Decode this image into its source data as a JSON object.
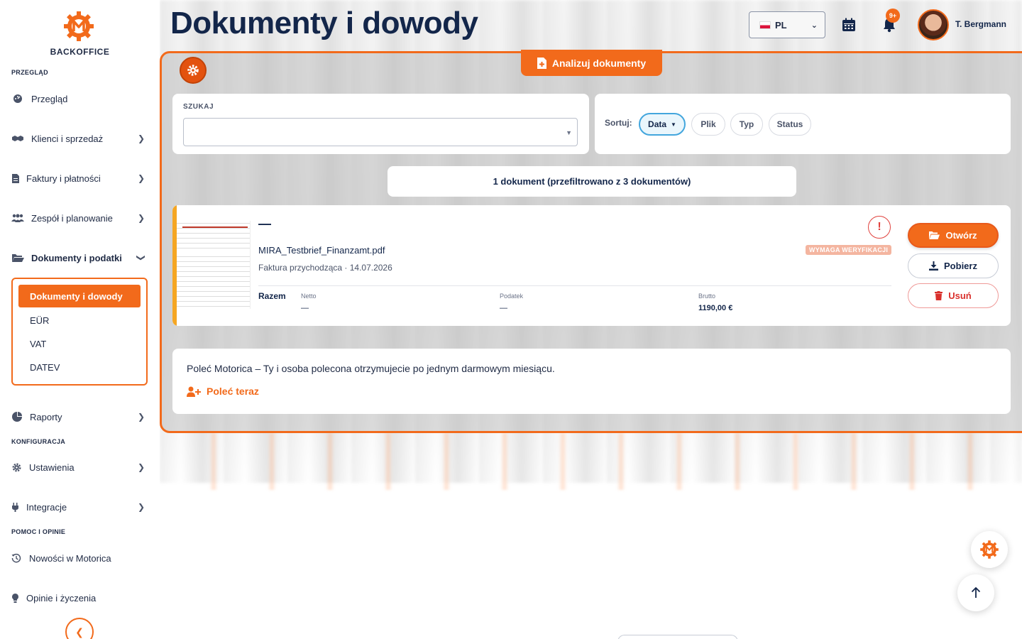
{
  "brand": {
    "name": "BACKOFFICE",
    "accent": "#f26a1b",
    "navy": "#13264a"
  },
  "header": {
    "title": "Dokumenty i dowody",
    "language": "PL",
    "notifications_badge": "9+",
    "user_name": "T. Bergmann"
  },
  "sidebar": {
    "sections": {
      "overview": "PRZEGLĄD",
      "config": "KONFIGURACJA",
      "help": "POMOC I OPINIE"
    },
    "items": {
      "overview": "Przegląd",
      "clients": "Klienci i sprzedaż",
      "invoices": "Faktury i płatności",
      "team": "Zespół i planowanie",
      "documents": "Dokumenty i podatki",
      "reports": "Raporty",
      "settings": "Ustawienia",
      "integrations": "Integracje",
      "news": "Nowości w Motorica",
      "feedback": "Opinie i życzenia"
    },
    "submenu": {
      "active": "Dokumenty i dowody",
      "eur": "EÜR",
      "vat": "VAT",
      "datev": "DATEV"
    }
  },
  "toolbar": {
    "analyze_label": "Analizuj dokumenty"
  },
  "search": {
    "label": "SZUKAJ",
    "value": "",
    "placeholder": ""
  },
  "sort": {
    "label": "Sortuj:",
    "options": {
      "date": "Data",
      "file": "Plik",
      "type": "Typ",
      "status": "Status"
    },
    "active_arrow": "▼"
  },
  "summary": {
    "count_text": "1 dokument (przefiltrowano z 3 dokumentów)"
  },
  "document": {
    "title_placeholder": "—",
    "filename": "MIRA_Testbrief_Finanzamt.pdf",
    "meta": "Faktura przychodząca · 14.07.2026",
    "status_badge": "WYMAGA WERYFIKACJI",
    "alert_symbol": "!",
    "totals": {
      "label": "Razem",
      "net_label": "Netto",
      "net_value": "—",
      "tax_label": "Podatek",
      "tax_value": "—",
      "gross_label": "Brutto",
      "gross_value": "1190,00 €"
    },
    "actions": {
      "open": "Otwórz",
      "download": "Pobierz",
      "delete": "Usuń"
    }
  },
  "promo": {
    "text": "Poleć Motorica – Ty i osoba polecona otrzymujecie po jednym darmowym miesiącu.",
    "link": "Poleć teraz"
  }
}
